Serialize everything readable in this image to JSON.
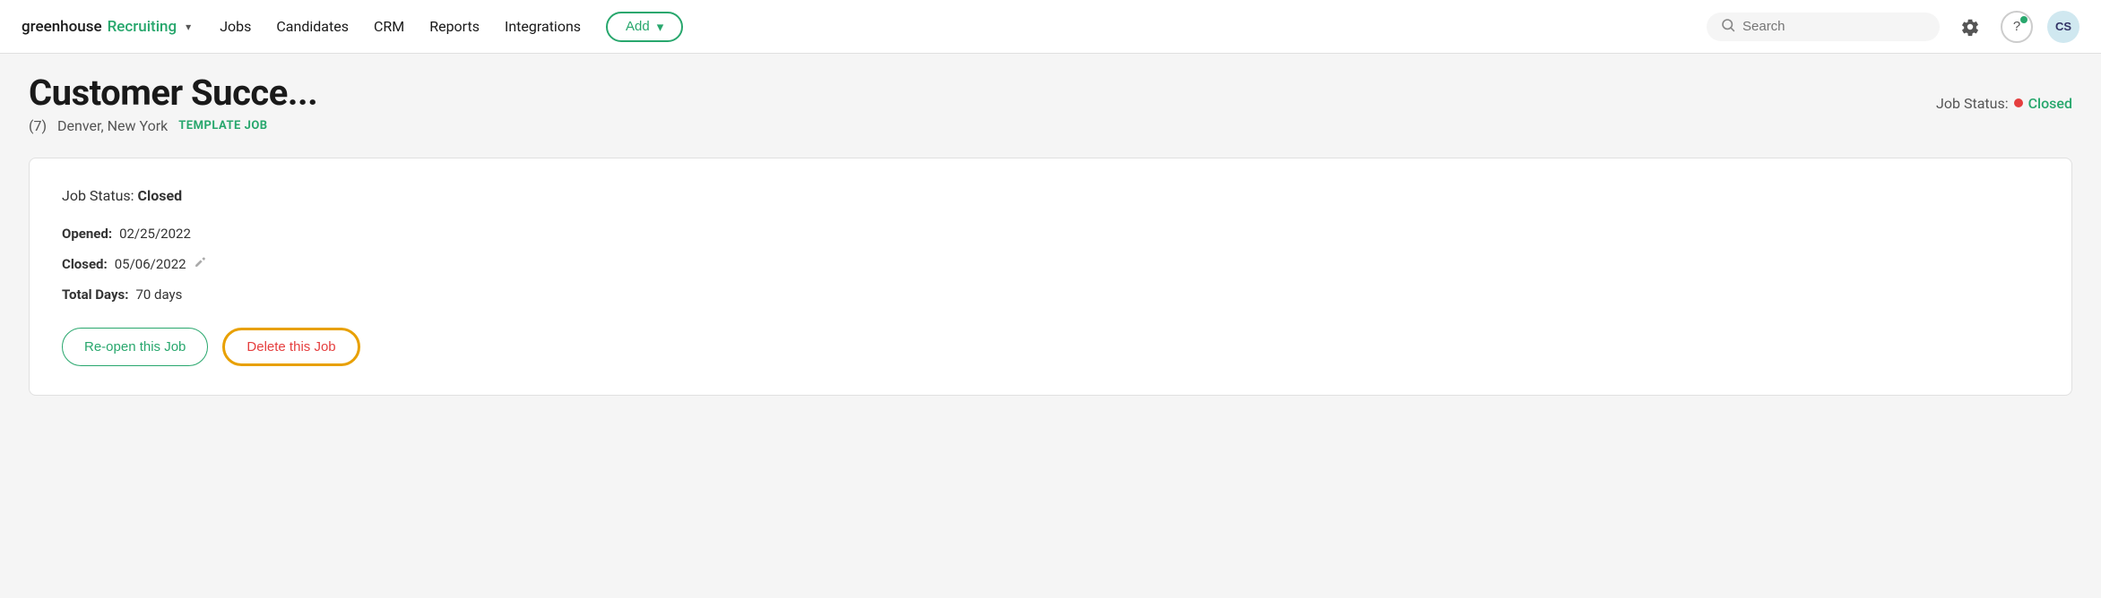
{
  "brand": {
    "name_prefix": "greenhouse",
    "name_suffix": "Recruiting",
    "chevron": "▾"
  },
  "nav": {
    "links": [
      "Jobs",
      "Candidates",
      "CRM",
      "Reports",
      "Integrations"
    ],
    "add_button": "Add",
    "add_chevron": "▾"
  },
  "search": {
    "placeholder": "Search"
  },
  "icons": {
    "search": "🔍",
    "settings": "⚙",
    "help": "?",
    "avatar": "CS"
  },
  "page_header": {
    "job_title": "Customer Succe...",
    "candidate_count": "(7)",
    "location": "Denver, New York",
    "template_label": "TEMPLATE JOB",
    "job_status_label": "Job Status:",
    "status_value": "Closed"
  },
  "card": {
    "status_label": "Job Status:",
    "status_value": "Closed",
    "opened_label": "Opened:",
    "opened_date": "02/25/2022",
    "closed_label": "Closed:",
    "closed_date": "05/06/2022",
    "total_days_label": "Total Days:",
    "total_days_value": "70 days",
    "btn_reopen": "Re-open this Job",
    "btn_delete": "Delete this Job"
  }
}
